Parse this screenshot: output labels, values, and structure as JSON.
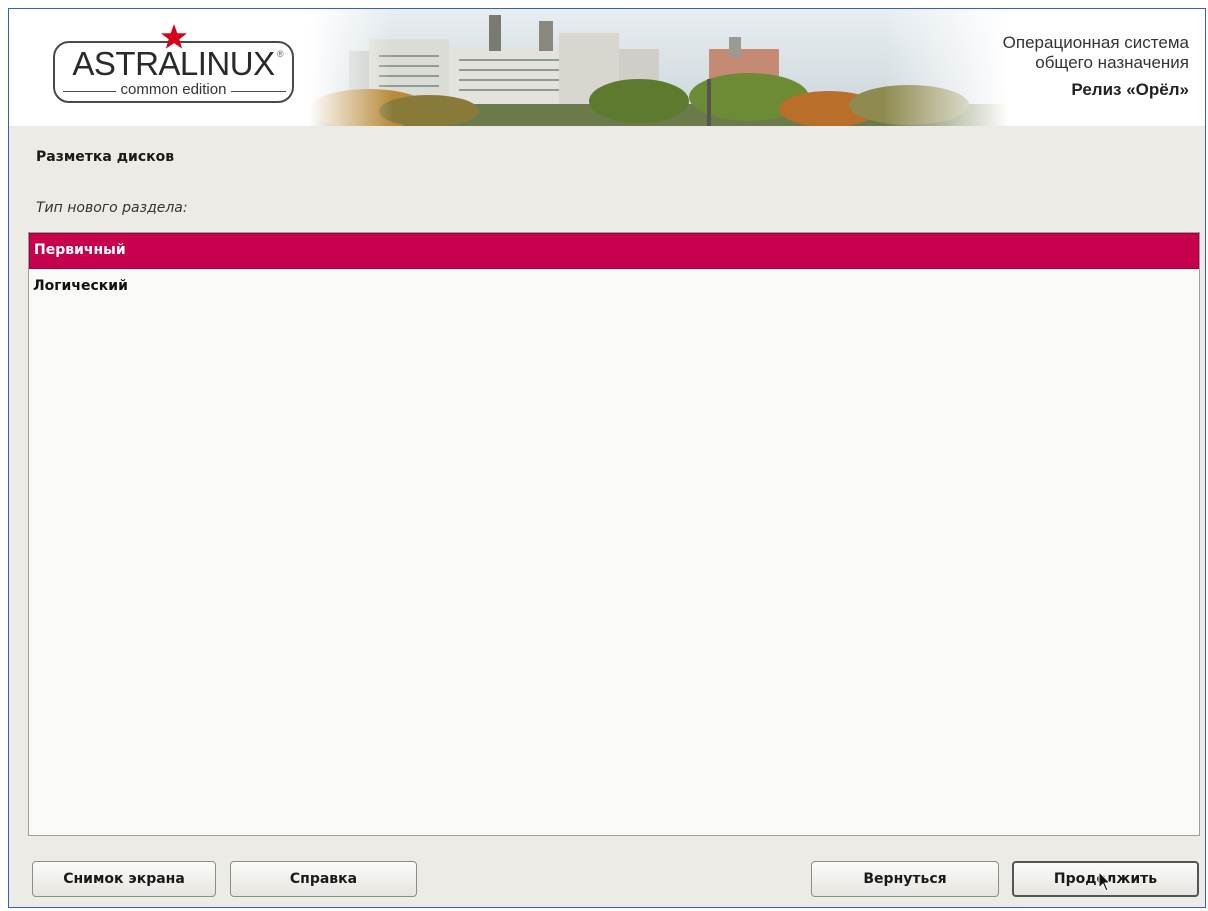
{
  "banner": {
    "logo": {
      "name": "ASTRALINUX",
      "registered": "®",
      "edition": "common edition"
    },
    "subtitle_line1": "Операционная система",
    "subtitle_line2": "общего назначения",
    "release": "Релиз «Орёл»"
  },
  "page": {
    "title": "Разметка дисков",
    "question": "Тип нового раздела:"
  },
  "partition_types": {
    "selected_index": 0,
    "items": [
      {
        "label": "Первичный"
      },
      {
        "label": "Логический"
      }
    ]
  },
  "buttons": {
    "screenshot": "Снимок экрана",
    "help": "Справка",
    "back": "Вернуться",
    "continue": "Продолжить"
  },
  "colors": {
    "selection": "#c7004e",
    "background": "#ecebe6",
    "star": "#d6001c"
  }
}
